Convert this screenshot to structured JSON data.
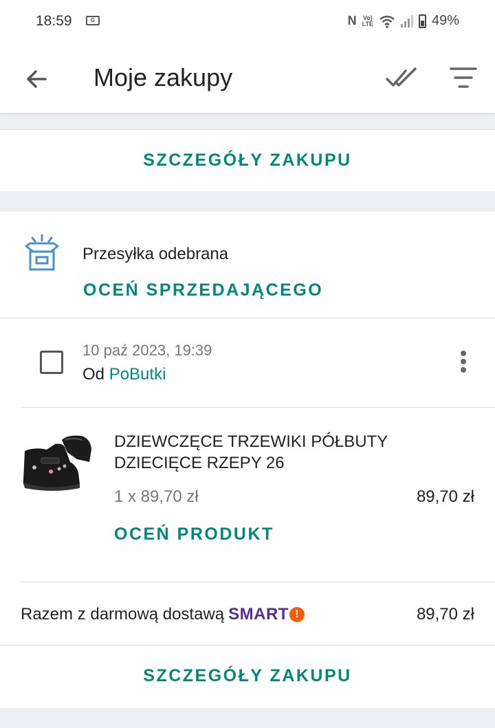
{
  "status_bar": {
    "time": "18:59",
    "gicon": "G",
    "nfc": "N",
    "lte_top": "Vo)",
    "lte_bottom": "LTE",
    "battery": "49%",
    "icons": [
      "gallery-icon",
      "nfc-icon",
      "volte-icon",
      "wifi-icon",
      "signal-icon",
      "battery-icon"
    ]
  },
  "app_bar": {
    "title": "Moje zakupy",
    "icons": [
      "back-arrow-icon",
      "double-check-icon",
      "filter-icon"
    ]
  },
  "top_panel": {
    "details_label": "SZCZEGÓŁY ZAKUPU"
  },
  "shipment": {
    "status": "Przesyłka odebrana",
    "rate_seller_label": "OCEŃ SPRZEDAJĄCEGO",
    "icon": "open-box-icon"
  },
  "order": {
    "date": "10 paź 2023, 19:39",
    "from_prefix": "Od ",
    "seller": "PoButki"
  },
  "product": {
    "name": "DZIEWCZĘCE TRZEWIKI PÓŁBUTY DZIECIĘCE RZEPY 26",
    "qty_price": "1 x 89,70 zł",
    "price": "89,70 zł",
    "rate_product_label": "OCEŃ PRODUKT"
  },
  "total": {
    "label": "Razem z darmową dostawą",
    "smart": "SMART",
    "smart_badge": "!",
    "price": "89,70 zł"
  },
  "bottom_panel": {
    "details_label": "SZCZEGÓŁY ZAKUPU"
  },
  "colors": {
    "accent": "#00897b",
    "smart": "#5c2d91",
    "smart_badge": "#ff5a00"
  }
}
